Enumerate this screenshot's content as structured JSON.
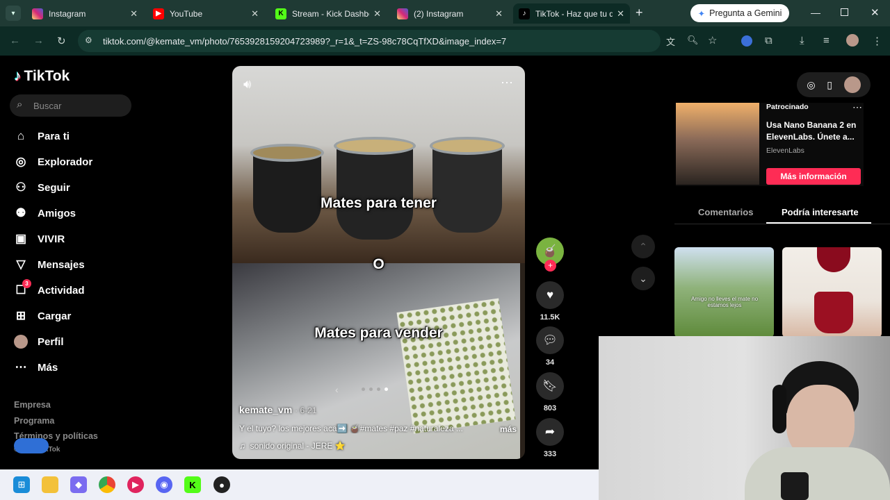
{
  "browser": {
    "tabs": [
      {
        "label": "Instagram",
        "favicon": "instagram-icon",
        "color": "#dd2a7b"
      },
      {
        "label": "YouTube",
        "favicon": "youtube-icon",
        "color": "#ff0000"
      },
      {
        "label": "Stream - Kick Dashbo",
        "favicon": "kick-icon",
        "color": "#53fc18"
      },
      {
        "label": "(2) Instagram",
        "favicon": "instagram-icon",
        "color": "#dd2a7b"
      },
      {
        "label": "TikTok - Haz que tu d",
        "favicon": "tiktok-icon",
        "color": "#000000"
      }
    ],
    "url": "tiktok.com/@kemate_vm/photo/7653928159204723989?_r=1&_t=ZS-98c78CqTfXD&image_index=7",
    "gemini_label": "Pregunta a Gemini"
  },
  "tiktok": {
    "logo": "TikTok",
    "search_placeholder": "Buscar",
    "nav": [
      {
        "label": "Para ti",
        "icon": "home-icon"
      },
      {
        "label": "Explorador",
        "icon": "compass-icon"
      },
      {
        "label": "Seguir",
        "icon": "user-follow-icon"
      },
      {
        "label": "Amigos",
        "icon": "friends-icon"
      },
      {
        "label": "VIVIR",
        "icon": "live-icon"
      },
      {
        "label": "Mensajes",
        "icon": "messages-icon"
      },
      {
        "label": "Actividad",
        "icon": "activity-icon",
        "badge": "3"
      },
      {
        "label": "Cargar",
        "icon": "upload-icon"
      },
      {
        "label": "Perfil",
        "icon": "avatar"
      },
      {
        "label": "Más",
        "icon": "more-icon"
      }
    ],
    "footer": [
      "Empresa",
      "Programa",
      "Términos y políticas",
      "© 2025 TikTok"
    ]
  },
  "video": {
    "overlay_top": "Mates para tener",
    "overlay_mid": "O",
    "overlay_bottom": "Mates para vender",
    "author": "kemate_vm",
    "date": "· 6-21",
    "caption": "Y el tuyo? los mejores aca➡️ 🧉#mates #paz #naturaleza ...",
    "more": "más",
    "sound": "sonido original - JERE ⭐"
  },
  "actions": {
    "likes": "11.5K",
    "comments": "34",
    "saves": "803",
    "shares": "333"
  },
  "ad": {
    "sponsored": "Patrocinado",
    "title": "Usa Nano Banana 2 en ElevenLabs. Únete a...",
    "advertiser": "ElevenLabs",
    "cta": "Más información"
  },
  "right_tabs": {
    "comments": "Comentarios",
    "suggested": "Podría interesarte"
  },
  "thumb1_caption": "Amigo no lleves el mate no estamos lejos",
  "colors": {
    "tiktok_red": "#fe2c55",
    "browser_frame": "#1f3a34"
  }
}
